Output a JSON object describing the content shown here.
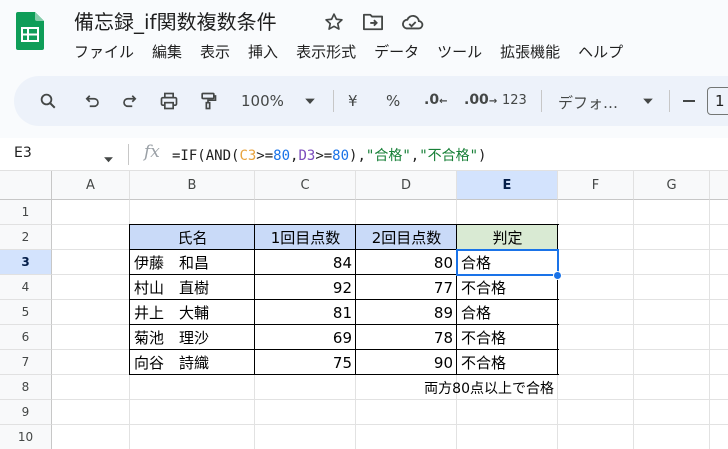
{
  "doc": {
    "title": "備忘録_if関数複数条件"
  },
  "menu": [
    "ファイル",
    "編集",
    "表示",
    "挿入",
    "表示形式",
    "データ",
    "ツール",
    "拡張機能",
    "ヘルプ"
  ],
  "toolbar": {
    "zoom": "100%",
    "currency": "¥",
    "percent": "%",
    "dec_decrease": ".0",
    "dec_increase": ".00",
    "number_format": "123",
    "font": "デフォ…",
    "font_size": "1"
  },
  "formula_bar": {
    "name_box": "E3",
    "fx": "fx",
    "formula": {
      "p1": "=IF(AND(",
      "ref1": "C3",
      "p2": ">=",
      "n1": "80",
      "p3": ",",
      "ref2": "D3",
      "p4": ">=",
      "n2": "80",
      "p5": "),",
      "s1": "\"合格\"",
      "p6": ",",
      "s2": "\"不合格\"",
      "p7": ")"
    }
  },
  "columns": [
    "A",
    "B",
    "C",
    "D",
    "E",
    "F",
    "G"
  ],
  "rows": [
    "1",
    "2",
    "3",
    "4",
    "5",
    "6",
    "7",
    "8",
    "9",
    "10"
  ],
  "table": {
    "headers": [
      "氏名",
      "1回目点数",
      "2回目点数",
      "判定"
    ],
    "records": [
      {
        "name": "伊藤　和昌",
        "score1": "84",
        "score2": "80",
        "result": "合格"
      },
      {
        "name": "村山　直樹",
        "score1": "92",
        "score2": "77",
        "result": "不合格"
      },
      {
        "name": "井上　大輔",
        "score1": "81",
        "score2": "89",
        "result": "合格"
      },
      {
        "name": "菊池　理沙",
        "score1": "69",
        "score2": "78",
        "result": "不合格"
      },
      {
        "name": "向谷　詩織",
        "score1": "75",
        "score2": "90",
        "result": "不合格"
      }
    ],
    "note": "両方80点以上で合格"
  },
  "selection": {
    "cell": "E3"
  },
  "colors": {
    "accent": "#1a73e8",
    "header_blue": "#c9daf8",
    "header_green": "#d9ead3",
    "sheets_green": "#0f9d58"
  }
}
